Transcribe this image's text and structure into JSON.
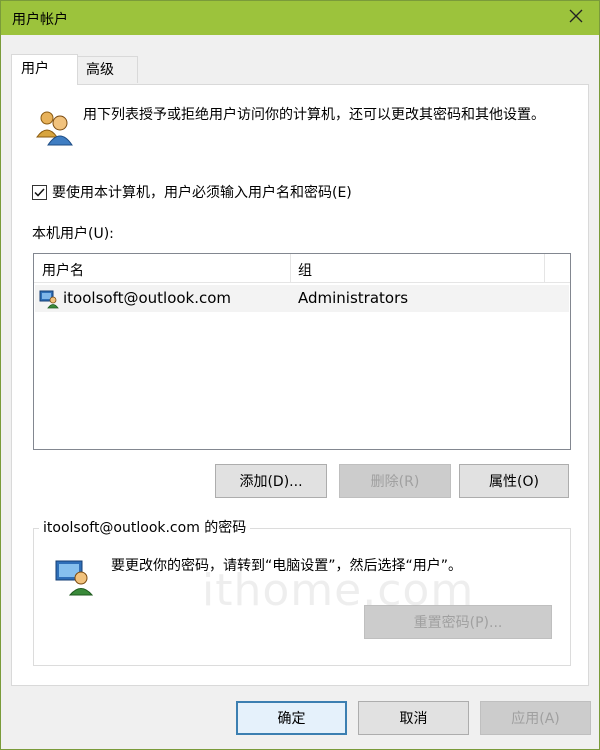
{
  "window": {
    "title": "用户帐户",
    "close_icon": "close-icon",
    "accent_color": "#9cc33c"
  },
  "tabs": [
    {
      "label": "用户",
      "active": true
    },
    {
      "label": "高级",
      "active": false
    }
  ],
  "intro": {
    "icon": "users-icon",
    "text": "用下列表授予或拒绝用户访问你的计算机，还可以更改其密码和其他设置。"
  },
  "require_password": {
    "checked": true,
    "label": "要使用本计算机，用户必须输入用户名和密码(E)"
  },
  "local_users": {
    "label": "本机用户(U):",
    "columns": [
      "用户名",
      "组"
    ],
    "rows": [
      {
        "name": "itoolsoft@outlook.com",
        "group": "Administrators",
        "icon": "user-account-icon"
      }
    ]
  },
  "buttons": {
    "add": "添加(D)...",
    "delete": "删除(R)",
    "properties": "属性(O)"
  },
  "password_group": {
    "title": "itoolsoft@outlook.com 的密码",
    "icon": "user-password-icon",
    "text": "要更改你的密码，请转到“电脑设置”，然后选择“用户”。",
    "reset_button": "重置密码(P)..."
  },
  "dialog_buttons": {
    "ok": "确定",
    "cancel": "取消",
    "apply": "应用(A)"
  },
  "watermark": "ithome.com"
}
